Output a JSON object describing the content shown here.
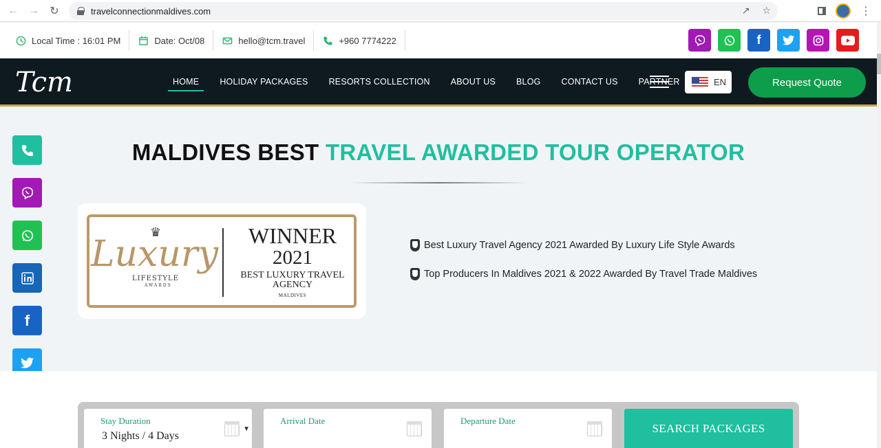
{
  "browser": {
    "url": "travelconnectionmaldives.com"
  },
  "infobar": {
    "local_time": "Local Time : 16:01 PM",
    "date": "Date: Oct/08",
    "email": "hello@tcm.travel",
    "phone": "+960 7774222"
  },
  "top_social": [
    "viber-icon",
    "whatsapp-icon",
    "facebook-icon",
    "twitter-icon",
    "instagram-icon",
    "youtube-icon"
  ],
  "nav": {
    "logo": "Tcm",
    "items": [
      "HOME",
      "HOLIDAY PACKAGES",
      "RESORTS COLLECTION",
      "ABOUT US",
      "BLOG",
      "CONTACT US",
      "PARTNER"
    ],
    "active": "HOME",
    "language": "EN",
    "quote_button": "Request Quote"
  },
  "side_social": [
    "phone-icon",
    "viber-icon",
    "whatsapp-icon",
    "linkedin-icon",
    "facebook-icon",
    "twitter-icon",
    "instagram-icon",
    "youtube-icon"
  ],
  "hero": {
    "title_plain": "MALDIVES BEST ",
    "title_accent": "TRAVEL AWARDED TOUR OPERATOR"
  },
  "award_badge": {
    "brand": "Luxury",
    "brand_sub": "LIFESTYLE",
    "brand_sub2": "AWARDS",
    "winner": "WINNER",
    "year": "2021",
    "category": "BEST LUXURY TRAVEL AGENCY",
    "region": "MALDIVES"
  },
  "awards": [
    "Best Luxury Travel Agency 2021 Awarded By Luxury Life Style Awards",
    "Top Producers In Maldives 2021 & 2022 Awarded By Travel Trade Maldives"
  ],
  "search": {
    "stay_label": "Stay Duration",
    "stay_value": "3 Nights / 4 Days",
    "arrival_label": "Arrival Date",
    "departure_label": "Departure Date",
    "button": "SEARCH PACKAGES"
  },
  "colors": {
    "accent": "#1fbf9f",
    "nav_bg": "#0f1a20",
    "quote_green": "#0d9d4b",
    "gold": "#c8a23b"
  }
}
